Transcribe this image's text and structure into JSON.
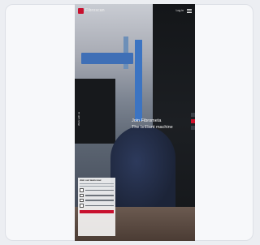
{
  "app": {
    "logo_text": "Fibroscan",
    "header_link": "Log in"
  },
  "hero": {
    "headline_line1": "Join Fibrometa",
    "headline_line2": "The brilliant machine",
    "vertical_label": "Work with us"
  },
  "form": {
    "title": "Join our team now"
  },
  "colors": {
    "accent": "#c8102e",
    "panel": "#f7f8fa"
  },
  "icons": [
    "menu-icon",
    "share-icon",
    "mail-icon",
    "linkedin-icon"
  ]
}
